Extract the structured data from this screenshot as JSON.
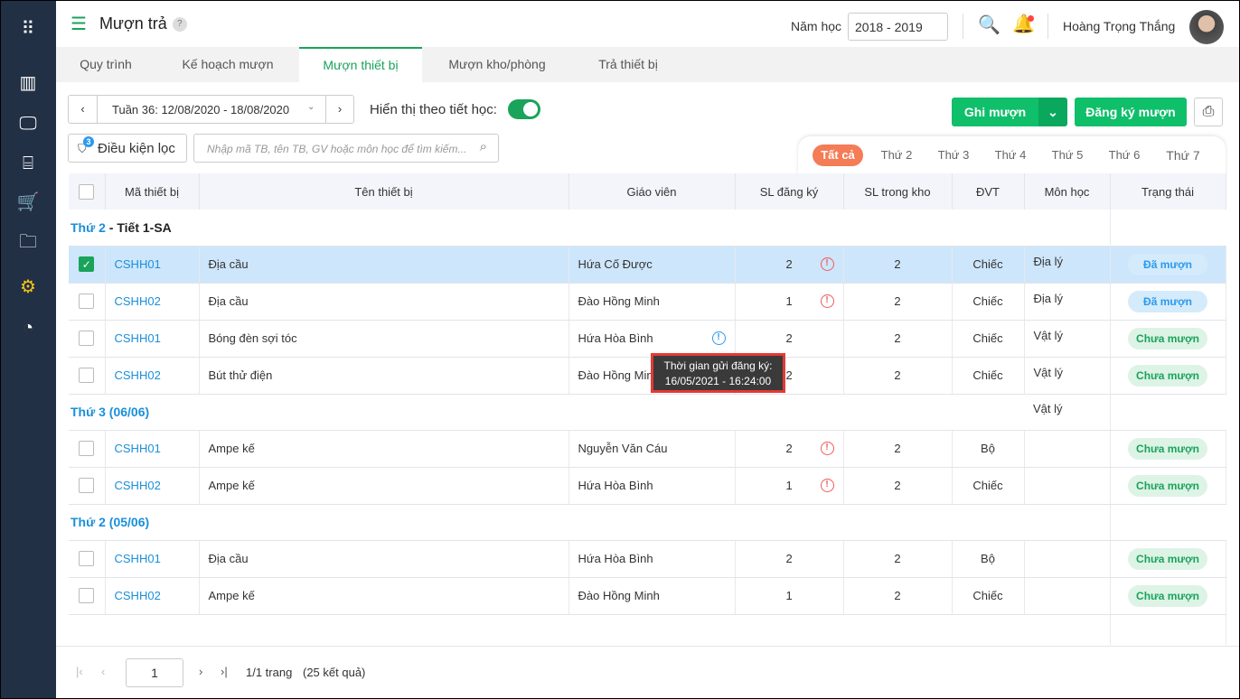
{
  "header": {
    "title": "Mượn trả",
    "help": "?",
    "year_label": "Năm học",
    "year_value": "2018 - 2019",
    "user": "Hoàng Trọng  Thắng"
  },
  "tabs": [
    "Quy trình",
    "Kế hoạch mượn",
    "Mượn thiết bị",
    "Mượn kho/phòng",
    "Trả thiết bị"
  ],
  "toolbar": {
    "week": "Tuần 36: 12/08/2020 - 18/08/2020",
    "show_by_period": "Hiển thị theo tiết học:",
    "filter": "Điều kiện lọc",
    "filter_count": "3",
    "search_placeholder": "Nhập mã TB, tên TB, GV hoặc môn học để tìm kiếm...",
    "borrow": "Ghi mượn",
    "register": "Đăng ký mượn"
  },
  "day_tabs": [
    "Tất cả",
    "Thứ 2",
    "Thứ 3",
    "Thứ 4",
    "Thứ 5",
    "Thứ 6",
    "Thứ 7"
  ],
  "columns": [
    "Mã thiết bị",
    "Tên thiết bị",
    "Giáo viên",
    "SL đăng ký",
    "SL trong kho",
    "ĐVT",
    "Môn học",
    "Trạng thái"
  ],
  "groups": [
    {
      "day": "Thứ 2",
      "suffix": " - Tiết 1-SA",
      "mon_hoc": "",
      "rows": [
        {
          "checked": true,
          "code": "CSHH01",
          "name": "Địa cầu",
          "teacher": "Hứa Cố Được",
          "reg": "2",
          "warn": true,
          "info": false,
          "stock": "2",
          "unit": "Chiếc",
          "subject": "Địa lý",
          "status": "Đã mượn",
          "done": true
        },
        {
          "checked": false,
          "code": "CSHH02",
          "name": "Địa cầu",
          "teacher": "Đào Hồng Minh",
          "reg": "1",
          "warn": true,
          "info": false,
          "stock": "2",
          "unit": "Chiếc",
          "subject": "Địa lý",
          "status": "Đã mượn",
          "done": true
        },
        {
          "checked": false,
          "code": "CSHH01",
          "name": "Bóng đèn sợi tóc",
          "teacher": "Hứa Hòa Bình",
          "reg": "2",
          "warn": false,
          "info": true,
          "stock": "2",
          "unit": "Chiếc",
          "subject": "Vật lý",
          "status": "Chưa mượn",
          "done": false
        },
        {
          "checked": false,
          "code": "CSHH02",
          "name": "Bút thử điện",
          "teacher": "Đào Hồng Minh",
          "reg": "2",
          "warn": false,
          "info": false,
          "stock": "2",
          "unit": "Chiếc",
          "subject": "Vật lý",
          "status": "Chưa mượn",
          "done": false
        }
      ]
    },
    {
      "day": "Thứ 3 (06/06)",
      "suffix": "",
      "mon_hoc": "Vật lý",
      "rows": [
        {
          "checked": false,
          "code": "CSHH01",
          "name": "Ampe kế",
          "teacher": "Nguyễn Văn Cáu",
          "reg": "2",
          "warn": true,
          "info": false,
          "stock": "2",
          "unit": "Bộ",
          "subject": "",
          "status": "Chưa mượn",
          "done": false
        },
        {
          "checked": false,
          "code": "CSHH02",
          "name": "Ampe kế",
          "teacher": "Hứa Hòa Bình",
          "reg": "1",
          "warn": true,
          "info": false,
          "stock": "2",
          "unit": "Chiếc",
          "subject": "",
          "status": "Chưa mượn",
          "done": false
        }
      ]
    },
    {
      "day": "Thứ 2 (05/06)",
      "suffix": "",
      "mon_hoc": "",
      "rows": [
        {
          "checked": false,
          "code": "CSHH01",
          "name": "Địa cầu",
          "teacher": "Hứa Hòa Bình",
          "reg": "2",
          "warn": false,
          "info": false,
          "stock": "2",
          "unit": "Bộ",
          "subject": "",
          "status": "Chưa mượn",
          "done": false
        },
        {
          "checked": false,
          "code": "CSHH02",
          "name": "Ampe kế",
          "teacher": "Đào Hồng Minh",
          "reg": "1",
          "warn": false,
          "info": false,
          "stock": "2",
          "unit": "Chiếc",
          "subject": "",
          "status": "Chưa mượn",
          "done": false
        }
      ]
    }
  ],
  "tooltip": {
    "line1": "Thời gian gửi đăng ký:",
    "line2": "16/05/2021 - 16:24:00"
  },
  "pagination": {
    "page": "1",
    "pages": "1/1 trang",
    "total": "(25 kết quả)"
  },
  "colors": {
    "sidebar": "#223045",
    "primary": "#0fbf6a",
    "active_day": "#f47c56",
    "link": "#1a8fd9"
  }
}
